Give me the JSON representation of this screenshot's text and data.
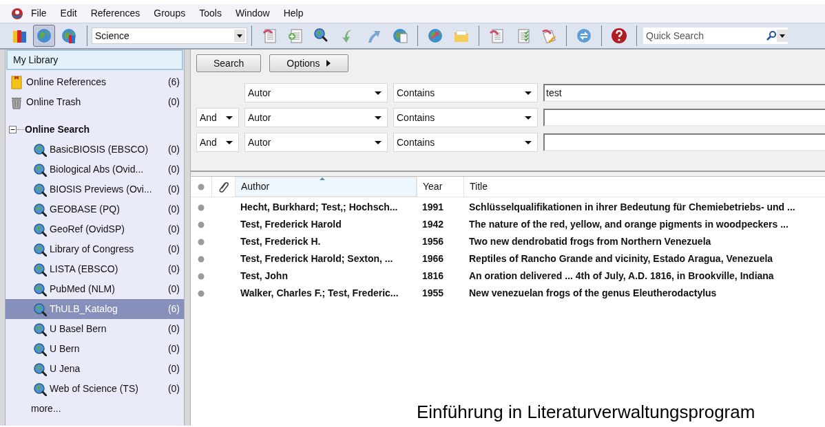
{
  "menu": [
    "File",
    "Edit",
    "References",
    "Groups",
    "Tools",
    "Window",
    "Help"
  ],
  "toolbar": {
    "mode_buttons": [
      {
        "selected": false
      },
      {
        "selected": true
      },
      {
        "selected": false
      }
    ],
    "style": "Science",
    "quick_search": {
      "placeholder": "Quick Search"
    }
  },
  "sidebar": {
    "header": "My Library",
    "items": [
      {
        "kind": "folder",
        "label": "Online References",
        "count": "(6)",
        "selected": false
      },
      {
        "kind": "trash",
        "label": "Online Trash",
        "count": "(0)",
        "selected": false
      }
    ],
    "group": {
      "label": "Online Search",
      "expanded": true,
      "children": [
        {
          "label": "BasicBIOSIS (EBSCO)",
          "count": "(0)",
          "selected": false
        },
        {
          "label": "Biological Abs (Ovid...",
          "count": "(0)",
          "selected": false
        },
        {
          "label": "BIOSIS Previews (Ovi...",
          "count": "(0)",
          "selected": false
        },
        {
          "label": "GEOBASE (PQ)",
          "count": "(0)",
          "selected": false
        },
        {
          "label": "GeoRef (OvidSP)",
          "count": "(0)",
          "selected": false
        },
        {
          "label": "Library of Congress",
          "count": "(0)",
          "selected": false
        },
        {
          "label": "LISTA (EBSCO)",
          "count": "(0)",
          "selected": false
        },
        {
          "label": "PubMed (NLM)",
          "count": "(0)",
          "selected": false
        },
        {
          "label": "ThULB_Katalog",
          "count": "(6)",
          "selected": true
        },
        {
          "label": "U Basel Bern",
          "count": "(0)",
          "selected": false
        },
        {
          "label": "U Bern",
          "count": "(0)",
          "selected": false
        },
        {
          "label": "U Jena",
          "count": "(0)",
          "selected": false
        },
        {
          "label": "Web of Science (TS)",
          "count": "(0)",
          "selected": false
        }
      ],
      "more": "more..."
    }
  },
  "search_panel": {
    "buttons": [
      "Search",
      "Options"
    ],
    "rows": [
      {
        "field": "Autor",
        "operator": "Contains",
        "value": "test"
      },
      {
        "connector": "And",
        "field": "Autor",
        "operator": "Contains"
      },
      {
        "connector": "And",
        "field": "Autor",
        "operator": "Contains"
      }
    ]
  },
  "table": {
    "columns": [
      "Author",
      "Year",
      "Title"
    ],
    "rows": [
      {
        "author": "Hecht, Burkhard; Test,; Hochsch...",
        "year": "1991",
        "title": "Schlüsselqualifikationen in ihrer Bedeutung für Chemiebetriebs- und ..."
      },
      {
        "author": "Test, Frederick Harold",
        "year": "1942",
        "title": "The nature of the red, yellow, and orange pigments in woodpeckers ..."
      },
      {
        "author": "Test, Frederick H.",
        "year": "1956",
        "title": "Two new dendrobatid frogs from Northern Venezuela"
      },
      {
        "author": "Test, Frederick Harold; Sexton, ...",
        "year": "1966",
        "title": "Reptiles of Rancho Grande and vicinity, Estado Aragua, Venezuela"
      },
      {
        "author": "Test, John",
        "year": "1816",
        "title": "An oration delivered ... 4th of July, A.D. 1816, in Brookville, Indiana"
      },
      {
        "author": "Walker, Charles F.; Test, Frederic...",
        "year": "1955",
        "title": "New venezuelan frogs of the genus Eleutherodactylus"
      }
    ]
  },
  "caption": "Einführung in Literaturverwaltungsprogram"
}
